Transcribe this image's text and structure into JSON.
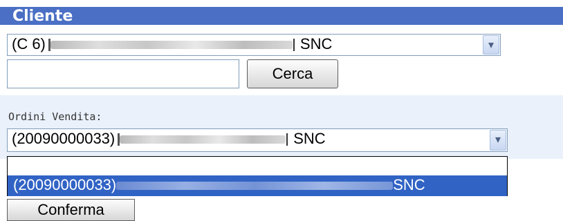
{
  "header": {
    "title": "Cliente"
  },
  "cliente_select": {
    "prefix": "(C 6)",
    "suffix": "SNC",
    "arrow_icon": "chevron-down-icon"
  },
  "search": {
    "value": "",
    "placeholder": "",
    "button_label": "Cerca"
  },
  "ordini": {
    "label": "Ordini Vendita:",
    "selected_prefix": "(20090000033)",
    "selected_suffix": "SNC",
    "options": [
      {
        "prefix": "",
        "suffix": ""
      },
      {
        "prefix": "(20090000033)",
        "suffix": "SNC"
      }
    ]
  },
  "confirm": {
    "label": "Conferma"
  },
  "colors": {
    "header": "#4a6fc4",
    "panel": "#eaf1fb",
    "highlight": "#3163c5"
  }
}
